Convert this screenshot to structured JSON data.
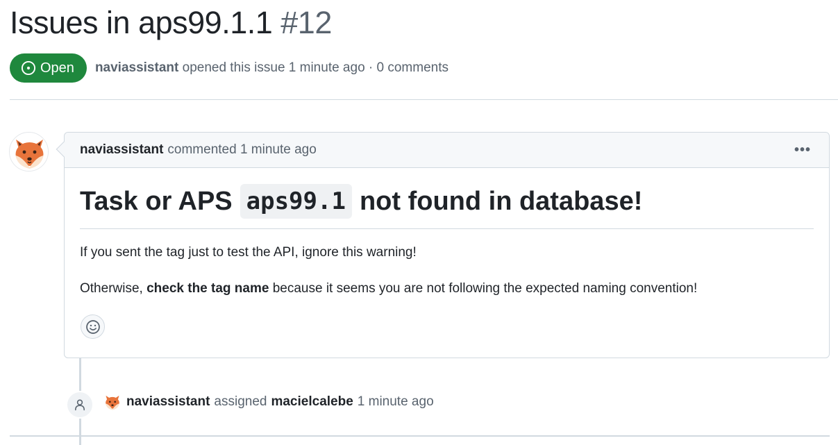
{
  "issue": {
    "title": "Issues in aps99.1.1",
    "number": "#12",
    "state": "Open",
    "author": "naviassistant",
    "opened_text": "opened this issue 1 minute ago · 0 comments"
  },
  "comment": {
    "author": "naviassistant",
    "action": "commented 1 minute ago",
    "menu_label": "•••",
    "heading_before": "Task or APS",
    "heading_code": "aps99.1",
    "heading_after": "not found in database!",
    "paragraph1": "If you sent the tag just to test the API, ignore this warning!",
    "paragraph2_before": "Otherwise,",
    "paragraph2_bold": "check the tag name",
    "paragraph2_after": "because it seems you are not following the expected naming convention!"
  },
  "event": {
    "actor": "naviassistant",
    "action": "assigned",
    "assignee": "macielcalebe",
    "time": "1 minute ago"
  },
  "colors": {
    "open_green": "#1f883d",
    "muted_text": "#59636e",
    "border": "#d1d9e0"
  },
  "icons": {
    "state": "issue-opened-icon",
    "avatar": "fox-avatar",
    "emoji": "smiley-icon",
    "event": "person-icon"
  }
}
